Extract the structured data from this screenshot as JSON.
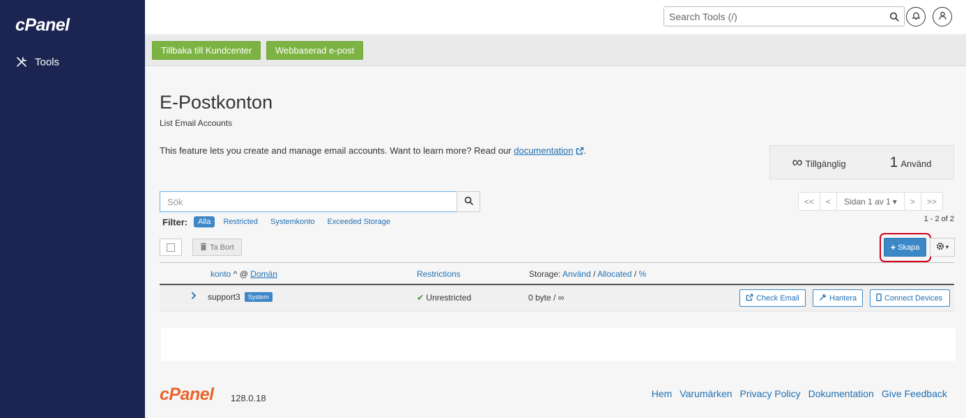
{
  "sidebar": {
    "brand": "cPanel",
    "items": [
      {
        "label": "Tools",
        "icon": "tools-icon"
      }
    ]
  },
  "topbar": {
    "search_placeholder": "Search Tools (/)"
  },
  "quicklinks": [
    {
      "label": "Tillbaka till Kundcenter"
    },
    {
      "label": "Webbaserad e-post"
    }
  ],
  "page": {
    "title": "E-Postkonton",
    "subtitle": "List Email Accounts",
    "intro_text": "This feature lets you create and manage email accounts. Want to learn more? Read our ",
    "intro_link": "documentation",
    "intro_end": "."
  },
  "stats": {
    "available_value": "∞",
    "available_label": "Tillgänglig",
    "used_value": "1",
    "used_label": "Använd"
  },
  "search": {
    "placeholder": "Sök"
  },
  "pager": {
    "first": "<<",
    "prev": "<",
    "current": "Sidan 1 av 1",
    "next": ">",
    "last": ">>",
    "count": "1 - 2 of 2"
  },
  "filter": {
    "label": "Filter:",
    "options": [
      "Alla",
      "Restricted",
      "Systemkonto",
      "Exceeded Storage"
    ],
    "active": "Alla"
  },
  "toolbar": {
    "delete_label": "Ta Bort",
    "create_label": "Skapa"
  },
  "table": {
    "col_account": "konto",
    "col_at": "@",
    "col_domain": "Domän",
    "col_restrictions": "Restrictions",
    "col_storage_prefix": "Storage:",
    "col_storage_used": "Använd",
    "col_storage_sep1": "/",
    "col_storage_alloc": "Allocated",
    "col_storage_sep2": "/",
    "col_storage_pct": "%",
    "rows": [
      {
        "account": "support3",
        "badge": "System",
        "restriction": "Unrestricted",
        "storage": "0 byte / ∞",
        "actions": [
          "Check Email",
          "Hantera",
          "Connect Devices"
        ]
      }
    ]
  },
  "footer": {
    "logo": "cPanel",
    "version": "128.0.18",
    "links": [
      "Hem",
      "Varumärken",
      "Privacy Policy",
      "Dokumentation",
      "Give Feedback"
    ]
  },
  "colors": {
    "sidebar": "#1c2452",
    "accent": "#3c87c6",
    "green": "#7cb342",
    "footer_logo": "#e8652d",
    "highlight_ring": "#d0001c"
  }
}
